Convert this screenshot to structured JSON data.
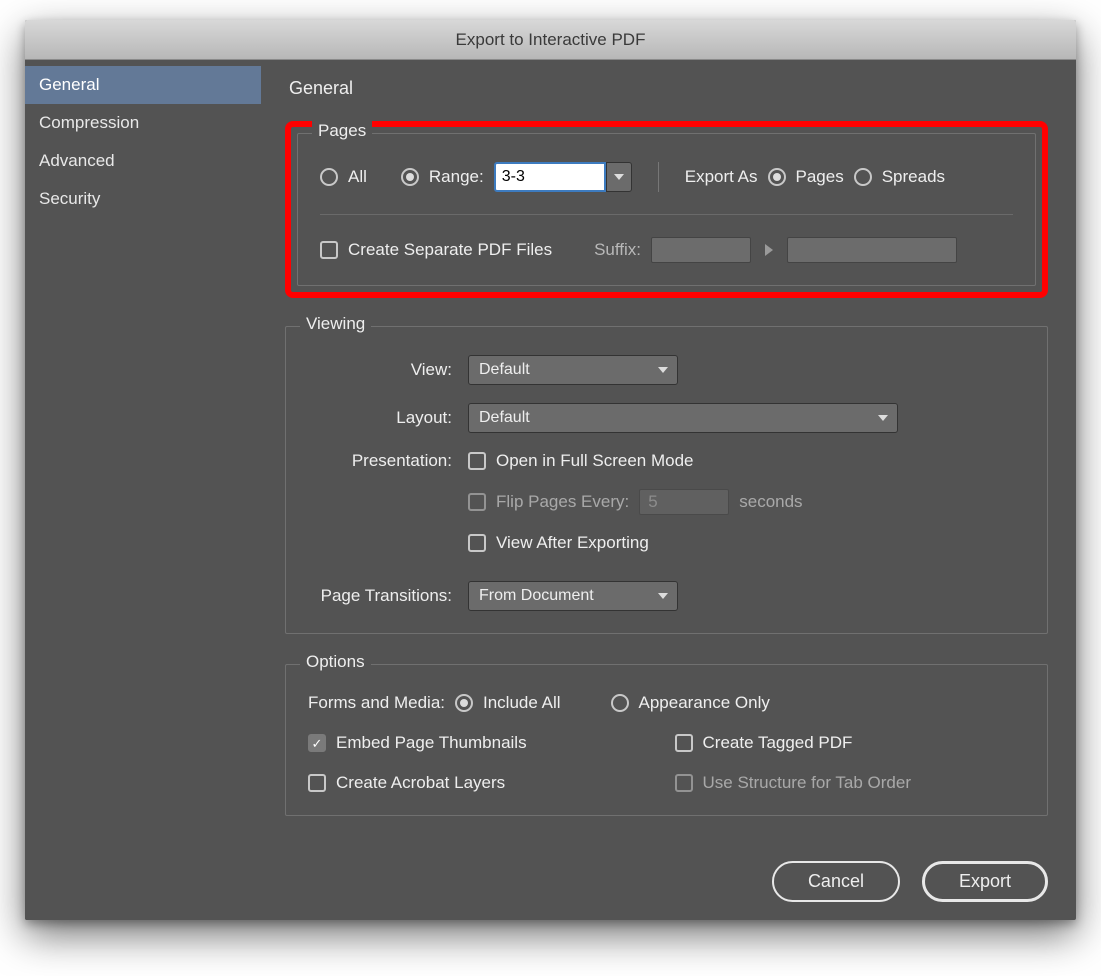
{
  "title": "Export to Interactive PDF",
  "sidebar": {
    "items": [
      {
        "label": "General",
        "active": true
      },
      {
        "label": "Compression",
        "active": false
      },
      {
        "label": "Advanced",
        "active": false
      },
      {
        "label": "Security",
        "active": false
      }
    ]
  },
  "section_heading": "General",
  "pages": {
    "legend": "Pages",
    "all_label": "All",
    "range_label": "Range:",
    "range_value": "3-3",
    "range_selected": "range",
    "export_as_label": "Export As",
    "pages_label": "Pages",
    "spreads_label": "Spreads",
    "export_as_selected": "pages",
    "create_separate_label": "Create Separate PDF Files",
    "create_separate_checked": false,
    "suffix_label": "Suffix:"
  },
  "viewing": {
    "legend": "Viewing",
    "view_label": "View:",
    "view_value": "Default",
    "layout_label": "Layout:",
    "layout_value": "Default",
    "presentation_label": "Presentation:",
    "fullscreen_label": "Open in Full Screen Mode",
    "fullscreen_checked": false,
    "flip_label": "Flip Pages Every:",
    "flip_value": "5",
    "flip_suffix": "seconds",
    "flip_enabled": false,
    "view_after_label": "View After Exporting",
    "view_after_checked": false,
    "transitions_label": "Page Transitions:",
    "transitions_value": "From Document"
  },
  "options": {
    "legend": "Options",
    "forms_label": "Forms and Media:",
    "include_all_label": "Include All",
    "appearance_label": "Appearance Only",
    "forms_selected": "include",
    "embed_thumbs_label": "Embed Page Thumbnails",
    "embed_thumbs_checked": true,
    "tagged_label": "Create Tagged PDF",
    "tagged_checked": false,
    "acro_layers_label": "Create Acrobat Layers",
    "acro_layers_checked": false,
    "tab_order_label": "Use Structure for Tab Order",
    "tab_order_enabled": false
  },
  "buttons": {
    "cancel": "Cancel",
    "export": "Export"
  }
}
